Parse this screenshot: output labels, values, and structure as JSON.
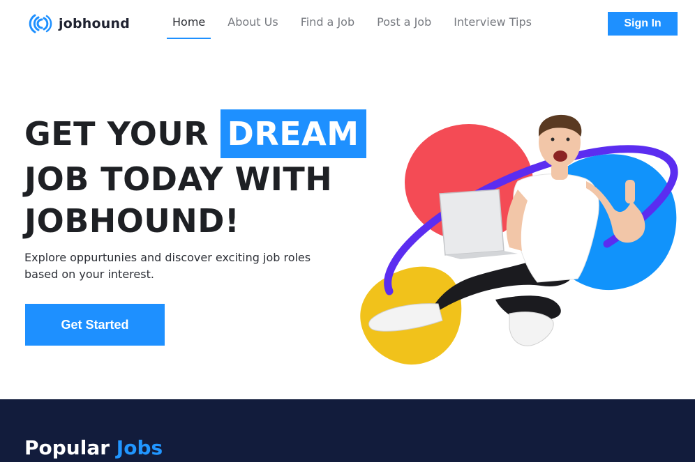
{
  "brand": {
    "name": "jobhound",
    "color": "#1e90ff"
  },
  "nav": {
    "items": [
      {
        "label": "Home",
        "active": true
      },
      {
        "label": "About Us",
        "active": false
      },
      {
        "label": "Find a Job",
        "active": false
      },
      {
        "label": "Post a Job",
        "active": false
      },
      {
        "label": "Interview Tips",
        "active": false
      }
    ],
    "signin_label": "Sign In"
  },
  "hero": {
    "line1": "GET YOUR",
    "highlight": "DREAM",
    "line2": "JOB TODAY WITH",
    "line3": "JOBHOUND!",
    "subtitle": "Explore oppurtunies and discover exciting job roles based on your interest.",
    "cta_label": "Get Started"
  },
  "popular": {
    "title_main": "Popular",
    "title_accent": "Jobs"
  },
  "colors": {
    "accent": "#1e90ff",
    "dark_section": "#121c3c",
    "blob_red": "#f44b55",
    "blob_blue": "#1193fb",
    "blob_yellow": "#f1c21b",
    "ring_purple": "#5b2df0"
  }
}
